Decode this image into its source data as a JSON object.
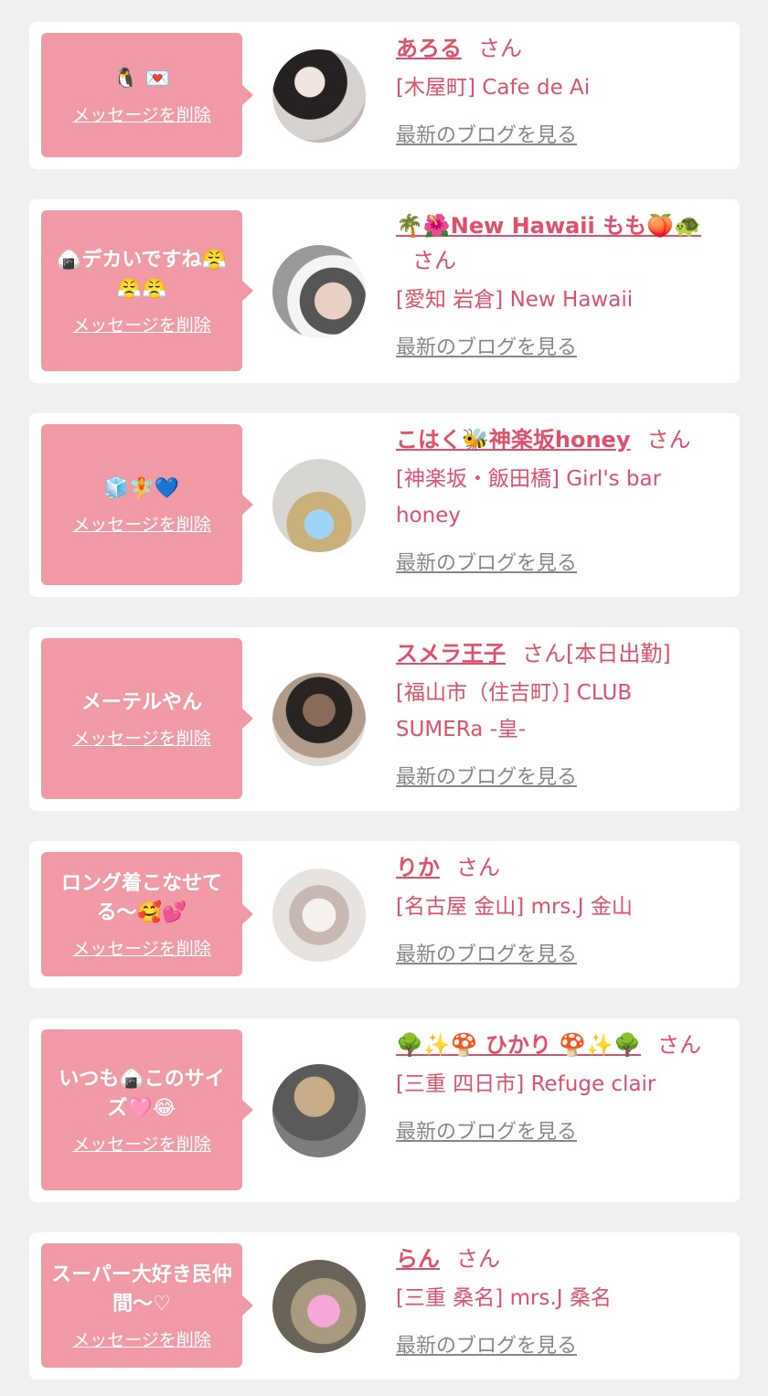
{
  "delete_label": "メッセージを削除",
  "blog_label": "最新のブログを見る",
  "items": [
    {
      "message": "🐧 💌",
      "name": "あろる",
      "suffix": "さん",
      "shop": "[木屋町] Cafe de Ai"
    },
    {
      "message": "🍙デカいですね😤😤😤",
      "name": "🌴🌺New Hawaii もも🍑🐢",
      "suffix": "さん",
      "shop": "[愛知 岩倉] New Hawaii"
    },
    {
      "message": "🧊🧚💙",
      "name": "こはく🐝神楽坂honey",
      "suffix": "さん",
      "shop": "[神楽坂・飯田橋] Girl's bar honey"
    },
    {
      "message": "メーテルやん",
      "name": "スメラ王子",
      "suffix": "さん[本日出勤]",
      "shop": "[福山市（住吉町）] CLUB SUMERa -皇-"
    },
    {
      "message": "ロング着こなせてる〜🥰💕",
      "name": "りか",
      "suffix": "さん",
      "shop": "[名古屋 金山] mrs.J 金山"
    },
    {
      "message": "いつも🍙このサイズ🩷😂",
      "name": "🌳✨🍄 ひかり 🍄✨🌳",
      "suffix": "さん",
      "shop": "[三重 四日市] Refuge clair"
    },
    {
      "message": "スーパー大好き民仲間〜♡",
      "name": "らん",
      "suffix": "さん",
      "shop": "[三重 桑名] mrs.J 桑名"
    }
  ]
}
